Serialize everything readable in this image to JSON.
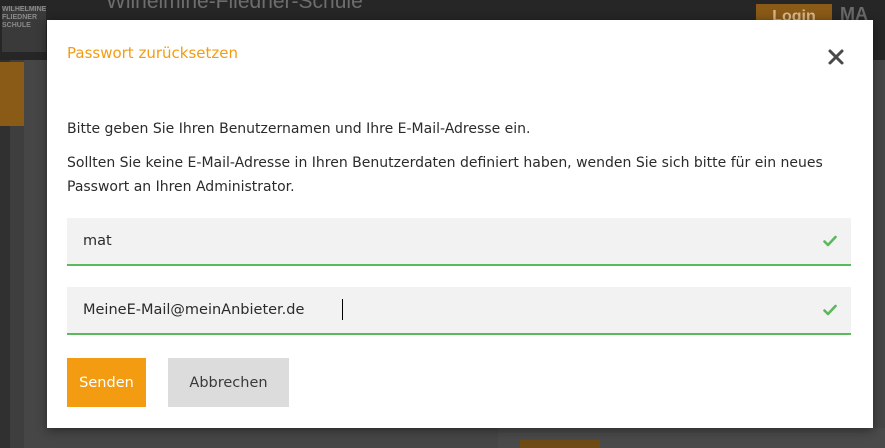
{
  "background": {
    "logo_lines": [
      "WILHELMINE",
      "FLIEDNER",
      "SCHULE"
    ],
    "school_name": "Wilhelmine-Fliedner-Schule",
    "login_label": "Login",
    "corner_text": "MA"
  },
  "modal": {
    "title": "Passwort zurücksetzen",
    "close_icon": "close-icon",
    "paragraph_1": "Bitte geben Sie Ihren Benutzernamen und Ihre E-Mail-Adresse ein.",
    "paragraph_2": "Sollten Sie keine E-Mail-Adresse in Ihren Benutzerdaten definiert haben, wenden Sie sich bitte für ein neues Passwort an Ihren Administrator.",
    "username_field": {
      "value": "mat",
      "valid_icon": "check-icon"
    },
    "email_field": {
      "value": "MeineE-Mail@meinAnbieter.de",
      "valid_icon": "check-icon"
    },
    "send_label": "Senden",
    "cancel_label": "Abbrechen"
  },
  "colors": {
    "accent": "#f39c12",
    "valid": "#5cb85c",
    "cancel_bg": "#dcdcdc",
    "overlay": "#3e3e3e"
  }
}
